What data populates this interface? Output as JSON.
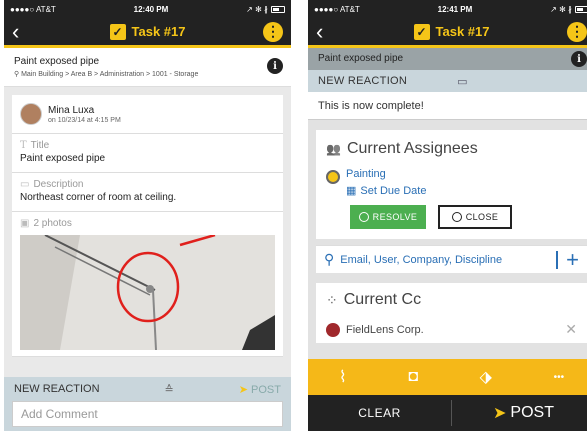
{
  "left": {
    "status": {
      "carrier": "●●●●○ AT&T",
      "time": "12:40 PM",
      "right": "↗ ✻ ∦"
    },
    "nav": {
      "back": "‹",
      "title": "Task #17",
      "check": "✓",
      "menu": "⋮"
    },
    "task": {
      "name": "Paint exposed pipe",
      "path": "Main Building > Area B > Administration > 1001 - Storage",
      "info": "i",
      "pin": "⚲"
    },
    "author": {
      "name": "Mina Luxa",
      "date": "on 10/23/14 at 4:15 PM"
    },
    "title_field": {
      "label": "Title",
      "value": "Paint exposed pipe",
      "icon": "T"
    },
    "description_field": {
      "label": "Description",
      "value": "Northeast corner of room at ceiling.",
      "icon": "▭"
    },
    "photos": {
      "label": "2 photos",
      "icon": "▣"
    },
    "reaction": {
      "label": "NEW REACTION",
      "handle": "≙",
      "post": "POST",
      "post_icon": "➤",
      "comment_placeholder": "Add Comment"
    }
  },
  "right": {
    "status": {
      "carrier": "●●●●○ AT&T",
      "time": "12:41 PM",
      "right": "↗ ✻ ∦"
    },
    "nav": {
      "back": "‹",
      "title": "Task #17",
      "check": "✓",
      "menu": "⋮"
    },
    "task": {
      "name": "Paint exposed pipe",
      "info": "i"
    },
    "reaction": {
      "label": "NEW REACTION",
      "handle": "▭",
      "message": "This is now complete!"
    },
    "assignees": {
      "title": "Current Assignees",
      "icon": "👥",
      "name": "Painting",
      "due_label": "Set Due Date",
      "due_icon": "▦",
      "resolve_label": "RESOLVE",
      "close_label": "CLOSE"
    },
    "search": {
      "placeholder": "Email, User, Company, Discipline",
      "icon": "⚲",
      "add": "+"
    },
    "cc": {
      "title": "Current Cc",
      "icon": "⁘",
      "company": "FieldLens Corp.",
      "remove": "✕"
    },
    "toolbar": {
      "attach": "⌇",
      "camera": "◘",
      "tag": "⬗",
      "more": "•••"
    },
    "actions": {
      "clear": "CLEAR",
      "post": "POST",
      "post_icon": "➤"
    }
  },
  "colors": {
    "accent": "#f5c518",
    "nav": "#222222",
    "link": "#2a6fb5",
    "resolve": "#4caf50",
    "annotation": "#e0201c"
  }
}
